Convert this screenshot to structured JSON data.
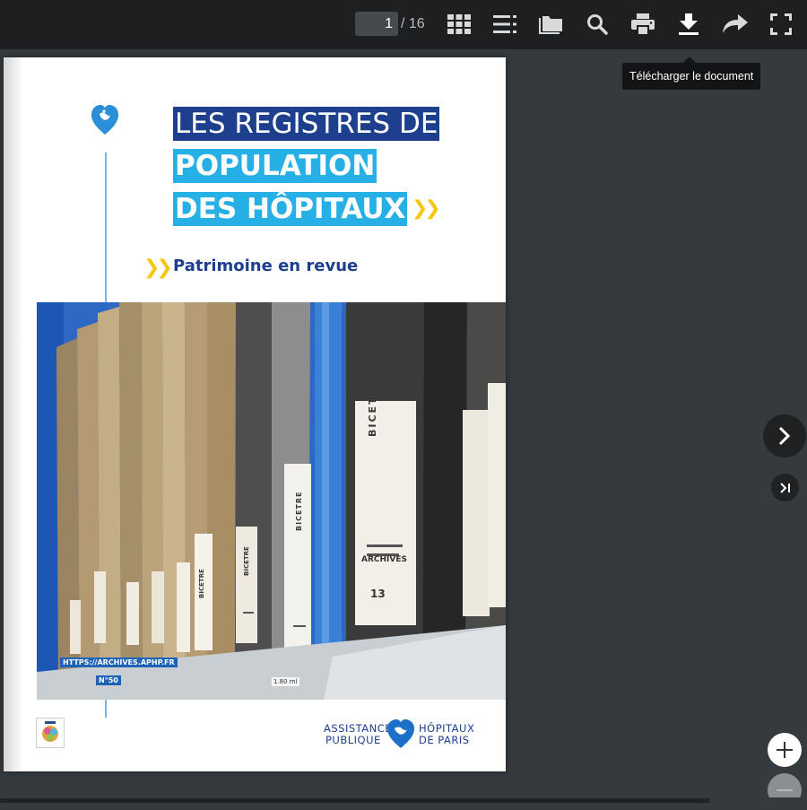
{
  "toolbar": {
    "page_current": "1",
    "page_total": "/ 16",
    "icons": {
      "thumbnails": "grid-icon",
      "outline": "list-icon",
      "attachments": "folder-icon",
      "search": "search-icon",
      "print": "print-icon",
      "download": "download-icon",
      "share": "share-icon",
      "fullscreen": "fullscreen-icon"
    },
    "tooltip": "Télécharger le document"
  },
  "document": {
    "title_line1": "LES REGISTRES DE",
    "title_line2": "POPULATION",
    "title_line3": "DES HÔPITAUX",
    "chevrons": "❯❯",
    "subtitle": "Patrimoine en revue",
    "photo_url_label": "HTTPS://ARCHIVES.APHP.FR",
    "photo_issue_label": "N°50",
    "spine_labels": [
      "BICETRE",
      "BICETRE",
      "BICETRE",
      "BICETRE"
    ],
    "spine_text": [
      "ARCHIVES",
      "13",
      "1.80 ml"
    ],
    "logo_left": "ASSISTANCE",
    "logo_left2": "PUBLIQUE",
    "logo_right": "HÔPITAUX",
    "logo_right2": "DE  PARIS"
  },
  "colors": {
    "toolbar_bg": "#1e1f21",
    "viewer_bg": "#343a3e",
    "title_navy": "#1d3f8e",
    "title_cyan": "#27b0e6",
    "accent_yellow": "#f6c614"
  },
  "nav": {
    "next_icon": "chevron-right-icon",
    "last_icon": "last-page-icon",
    "zoom_in_icon": "plus-icon",
    "zoom_out_icon": "minus-icon"
  }
}
